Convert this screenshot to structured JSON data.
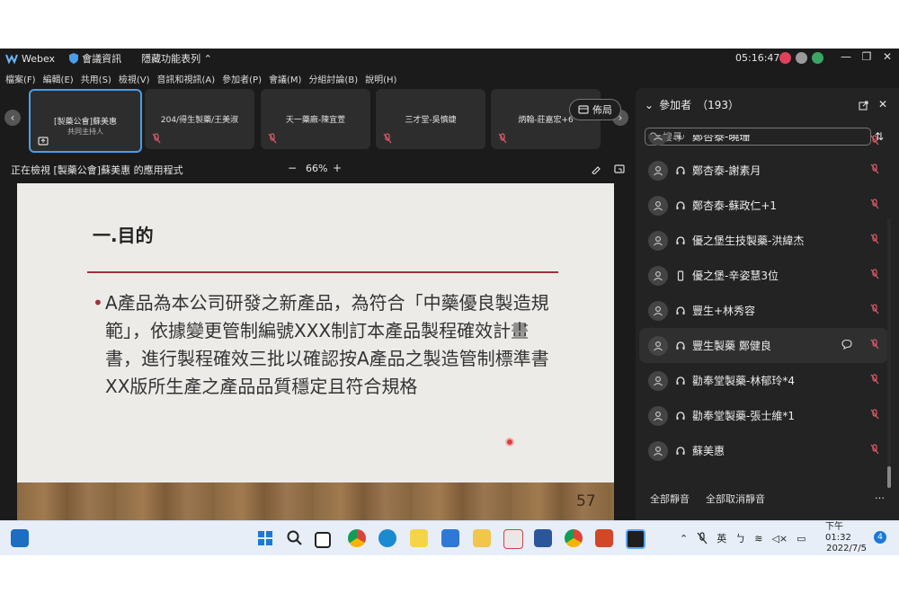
{
  "titlebar": {
    "app_name": "Webex",
    "meeting_info": "會議資訊",
    "hidden_menu": "隱藏功能表列",
    "time": "05:16:47"
  },
  "menu": [
    "檔案(F)",
    "編輯(E)",
    "共用(S)",
    "檢視(V)",
    "音訊和視訊(A)",
    "參加者(P)",
    "會議(M)",
    "分組討論(B)",
    "說明(H)"
  ],
  "tiles": [
    {
      "name": "[製藥公會]蘇美惠",
      "sub": "共同主持人"
    },
    {
      "name": "204/得生製藥/王美淑",
      "sub": ""
    },
    {
      "name": "天一藥廠-陳宜萱",
      "sub": ""
    },
    {
      "name": "三才堂-吳慎婕",
      "sub": ""
    },
    {
      "name": "炳翰-莊嘉宏+6",
      "sub": ""
    }
  ],
  "layout_label": "佈局",
  "viewbar": {
    "viewing_text": "正在檢視 [製藥公會]蘇美惠 的應用程式",
    "zoom": "66%",
    "zoom_minus": "−",
    "zoom_plus": "+"
  },
  "slide": {
    "heading": "一.目的",
    "bullet": "A產品為本公司研發之新產品，為符合「中藥優良製造規範」，依據變更管制編號XXX制訂本產品製程確效計畫書，進行製程確效三批以確認按A產品之製造管制標準書XX版所生產之產品品質穩定且符合規格",
    "page_number": "57"
  },
  "panel": {
    "title": "參加者",
    "count": "（193）",
    "search_placeholder": "搜尋",
    "participants": [
      {
        "name": "鄭杏泰-曉珊",
        "type": "phone",
        "muted": true
      },
      {
        "name": "鄭杏泰-謝素月",
        "type": "computer-audio",
        "muted": true
      },
      {
        "name": "鄭杏泰-蘇政仁+1",
        "type": "computer-audio",
        "muted": true
      },
      {
        "name": "優之堡生技製藥-洪緯杰",
        "type": "computer-audio",
        "muted": true
      },
      {
        "name": "優之堡-辛姿慧3位",
        "type": "mobile",
        "muted": true
      },
      {
        "name": "豐生+林秀容",
        "type": "computer-audio",
        "muted": true
      },
      {
        "name": "豐生製藥 鄭健良",
        "type": "computer-audio",
        "muted": true,
        "highlighted": true
      },
      {
        "name": "勸奉堂製藥-林郁玲*4",
        "type": "computer-audio",
        "muted": true
      },
      {
        "name": "勸奉堂製藥-張士維*1",
        "type": "computer-audio",
        "muted": true
      },
      {
        "name": "蘇美惠",
        "type": "computer-audio",
        "muted": true
      }
    ],
    "mute_all": "全部靜音",
    "unmute_all": "全部取消靜音",
    "more": "…"
  },
  "taskbar": {
    "ime": "英",
    "time": "下午 01:32",
    "date": "2022/7/5",
    "notifications": "4"
  },
  "colors": {
    "accent_blue": "#4a9ee8",
    "slide_rule": "#a0303c",
    "mute_red": "#e05a6a"
  }
}
